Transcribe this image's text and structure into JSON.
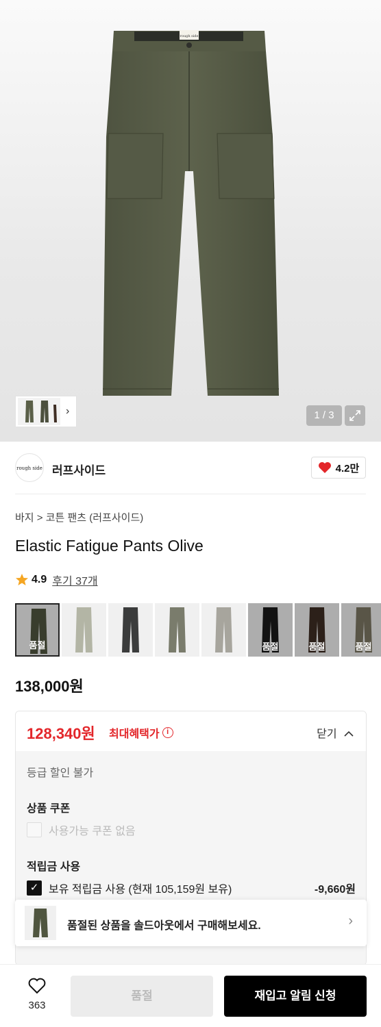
{
  "gallery": {
    "counter": "1 / 3",
    "brand_tag": "rough side"
  },
  "brand": {
    "logo_text": "rough side",
    "name": "러프사이드",
    "likes": "4.2만"
  },
  "breadcrumb": {
    "category": "바지",
    "separator": ">",
    "subcategory": "코튼 팬츠 (러프사이드)"
  },
  "product": {
    "title": "Elastic Fatigue Pants Olive",
    "rating": "4.9",
    "reviews": "후기 37개",
    "price": "138,000원"
  },
  "color_options": [
    {
      "color": "#4f553f",
      "soldout": "품절"
    },
    {
      "color": "#b3b5a5",
      "soldout": ""
    },
    {
      "color": "#3b3c3c",
      "soldout": ""
    },
    {
      "color": "#7a7c6c",
      "soldout": ""
    },
    {
      "color": "#a7a59d",
      "soldout": ""
    },
    {
      "color": "#1a1a1a",
      "soldout": "품절"
    },
    {
      "color": "#3e2d23",
      "soldout": "품절"
    },
    {
      "color": "#7c7663",
      "soldout": "품절"
    }
  ],
  "benefit": {
    "max_price": "128,340원",
    "max_label": "최대혜택가",
    "info_icon": "i",
    "close_label": "닫기",
    "grade_text": "등급 할인 불가",
    "coupon_heading": "상품 쿠폰",
    "coupon_text": "사용가능 쿠폰 없음",
    "point_heading": "적립금 사용",
    "point_text": "보유 적립금 사용 (현재 105,159원 보유)",
    "point_amount": "-9,660원",
    "check_mark": "✓"
  },
  "sold_banner": {
    "text": "품절된 상품을 솔드아웃에서 구매해보세요."
  },
  "bottom_bar": {
    "like_count": "363",
    "soldout_label": "품절",
    "restock_label": "재입고 알림 신청"
  },
  "colors": {
    "accent_red": "#e3262a",
    "olive": "#5a5f48"
  }
}
